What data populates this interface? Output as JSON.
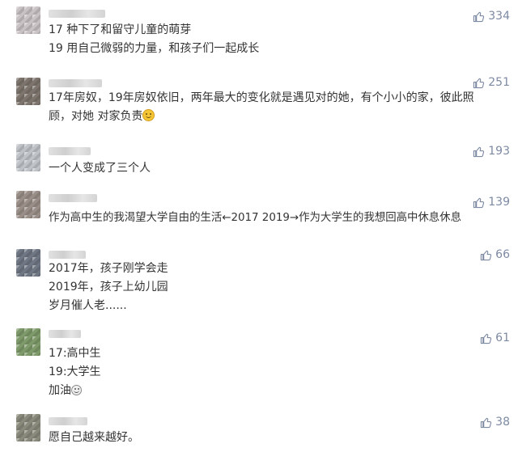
{
  "comments": [
    {
      "likes": "334",
      "avatar_color": "#c9c2c4",
      "lines": [
        "17 种下了和留守儿童的萌芽",
        "19 用自己微弱的力量，和孩子们一起成长"
      ]
    },
    {
      "likes": "251",
      "avatar_color": "#7d756d",
      "lines": [
        "17年房奴，19年房奴依旧，两年最大的变化就是遇见对的她，有个小小的家，彼此照",
        "顾，对她 对家负责"
      ],
      "emoji": "smile-emoji"
    },
    {
      "likes": "193",
      "avatar_color": "#bfc3c7",
      "lines": [
        "一个人变成了三个人"
      ]
    },
    {
      "likes": "139",
      "avatar_color": "#9a8f88",
      "lines": [
        "作为高中生的我渴望大学自由的生活←2017 2019→作为大学生的我想回高中休息休息"
      ]
    },
    {
      "likes": "66",
      "avatar_color": "#6f7784",
      "lines": [
        "2017年，孩子刚学会走",
        "2019年，孩子上幼儿园",
        "岁月催人老......"
      ]
    },
    {
      "likes": "61",
      "avatar_color": "#7e9a6a",
      "lines": [
        "17:高中生",
        "19:大学生",
        "加油"
      ],
      "emoji": "grin-emoji"
    },
    {
      "likes": "38",
      "avatar_color": "#8a8a7c",
      "lines": [
        "愿自己越来越好。"
      ]
    }
  ],
  "icons": {
    "like": "thumbs-up-icon"
  },
  "colors": {
    "like_text": "#7d8aa3",
    "content_text": "#333333"
  }
}
